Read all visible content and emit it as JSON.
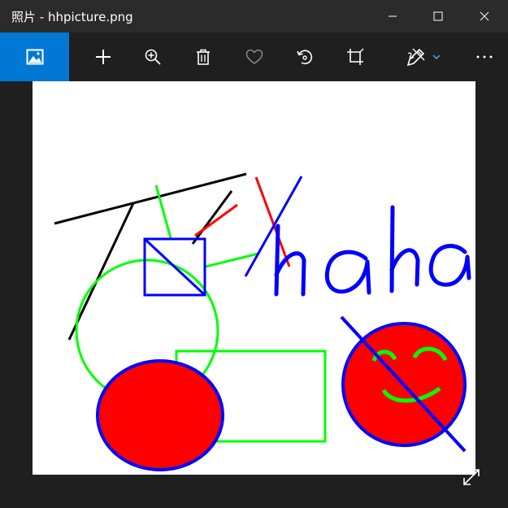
{
  "window": {
    "title": "照片 - hhpicture.png",
    "controls": {
      "minimize_icon": "minimize-icon",
      "maximize_icon": "maximize-icon",
      "close_icon": "close-icon"
    }
  },
  "toolbar": {
    "accent_color": "#0078d4",
    "buttons": [
      {
        "name": "see-all-photos",
        "icon": "photo-collection-icon",
        "active": true
      },
      {
        "name": "add-to-album",
        "icon": "plus-icon"
      },
      {
        "name": "zoom",
        "icon": "zoom-in-icon"
      },
      {
        "name": "delete",
        "icon": "trash-icon"
      },
      {
        "name": "favorite",
        "icon": "heart-icon",
        "disabled": true
      },
      {
        "name": "rotate",
        "icon": "rotate-icon"
      },
      {
        "name": "crop",
        "icon": "crop-icon"
      },
      {
        "name": "edit-and-create",
        "icon": "edit-draw-icon",
        "has_dropdown": true
      },
      {
        "name": "more",
        "icon": "more-icon"
      }
    ]
  },
  "image": {
    "file_name": "hhpicture.png",
    "drawing_text": "haha",
    "colors": {
      "black": "#000000",
      "green": "#00ff00",
      "red": "#ff0000",
      "blue": "#0000ff",
      "background": "#ffffff"
    }
  },
  "viewer": {
    "fullscreen_icon": "expand-icon"
  }
}
